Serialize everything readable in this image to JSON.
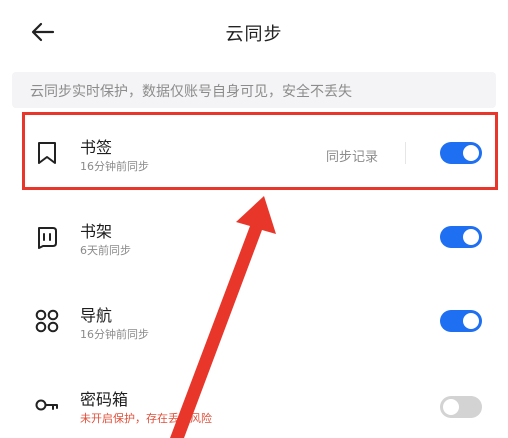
{
  "header": {
    "title": "云同步",
    "back_icon": "arrow-left-icon"
  },
  "notice": {
    "text": "云同步实时保护，数据仅账号自身可见，安全不丢失"
  },
  "items": [
    {
      "title": "书签",
      "subtitle": "16分钟前同步",
      "link": "同步记录",
      "icon": "bookmark-icon",
      "enabled": true
    },
    {
      "title": "书架",
      "subtitle": "6天前同步",
      "icon": "bookshelf-icon",
      "enabled": true
    },
    {
      "title": "导航",
      "subtitle": "16分钟前同步",
      "icon": "grid-dots-icon",
      "enabled": true
    },
    {
      "title": "密码箱",
      "subtitle": "未开启保护，存在丢失风险",
      "icon": "key-icon",
      "enabled": false
    }
  ],
  "colors": {
    "accent": "#1e6ff2",
    "toggle_off": "#d3d3d3",
    "warning": "#e0503a",
    "annotation": "#e8372a"
  }
}
